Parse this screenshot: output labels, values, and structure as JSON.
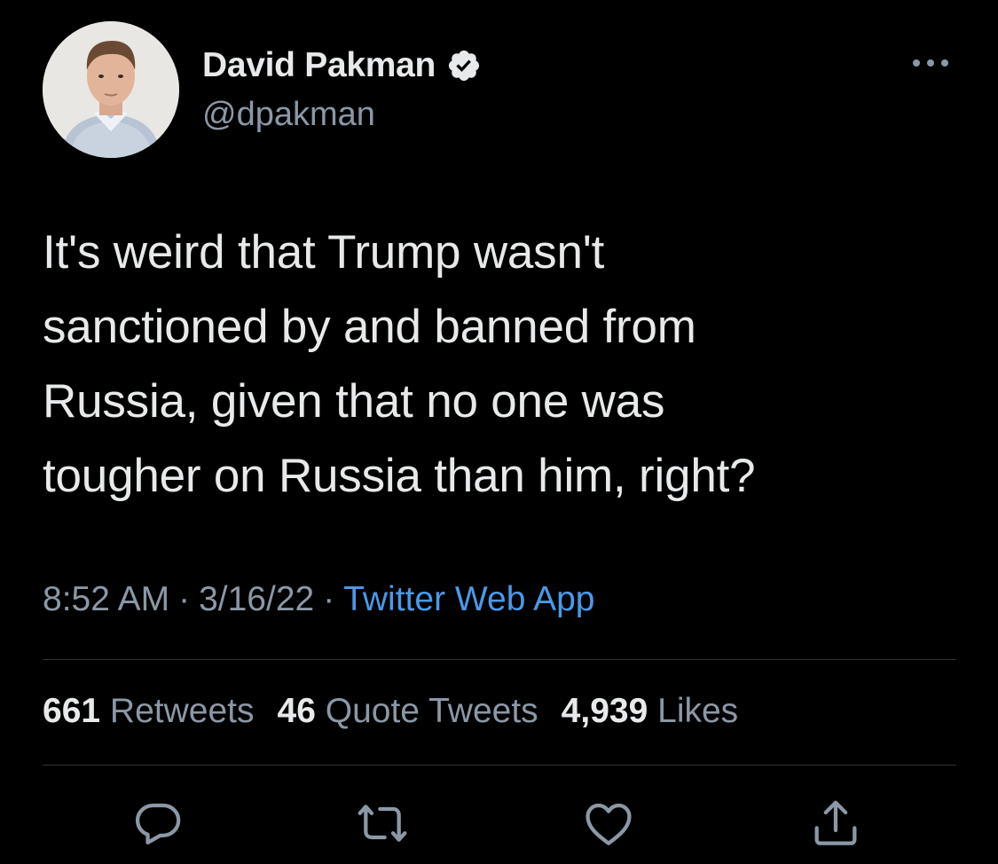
{
  "author": {
    "display_name": "David Pakman",
    "handle": "@dpakman",
    "verified": true,
    "avatar_icon": "profile-photo"
  },
  "tweet": {
    "lines": [
      "It's weird that Trump wasn't",
      "sanctioned by and banned from",
      "Russia, given that no one was",
      "tougher on Russia than him, right?"
    ]
  },
  "meta": {
    "time": "8:52 AM",
    "date": "3/16/22",
    "separator": "·",
    "source": "Twitter Web App"
  },
  "stats": {
    "retweets_count": "661",
    "retweets_label": "Retweets",
    "quotes_count": "46",
    "quotes_label": "Quote Tweets",
    "likes_count": "4,939",
    "likes_label": "Likes"
  },
  "actions": {
    "icons": [
      "reply-icon",
      "retweet-icon",
      "like-icon",
      "share-icon"
    ]
  },
  "colors": {
    "background": "#000000",
    "text_primary": "#e7e9ea",
    "text_secondary": "#8b98a5",
    "link": "#4a99e9",
    "divider": "#2f3336"
  }
}
